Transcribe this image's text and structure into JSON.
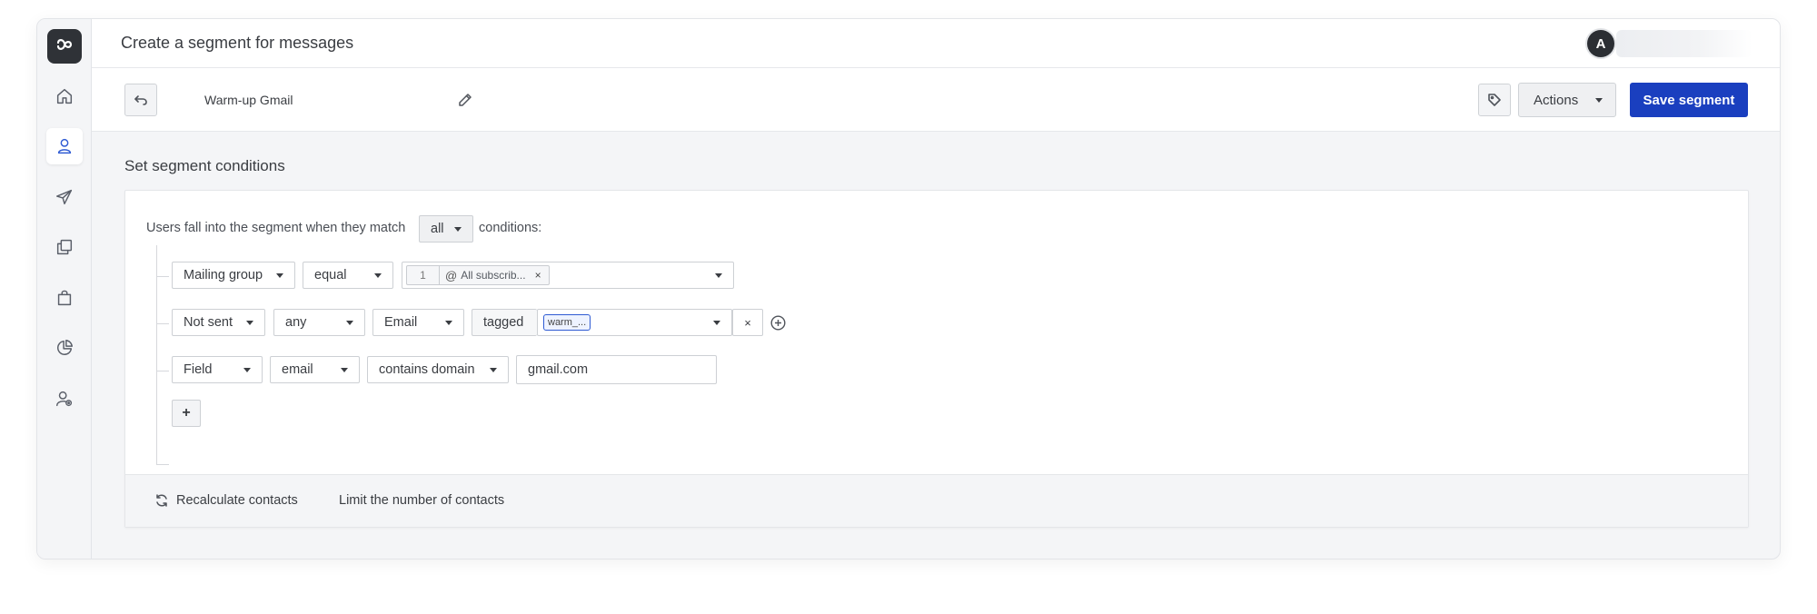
{
  "header": {
    "page_title": "Create a segment for messages",
    "avatar_initial": "A"
  },
  "toolbar": {
    "segment_name": "Warm-up Gmail",
    "actions_label": "Actions",
    "save_label": "Save segment"
  },
  "sidebar": {
    "items": [
      {
        "icon": "home-icon",
        "active": false
      },
      {
        "icon": "user-icon",
        "active": true
      },
      {
        "icon": "send-icon",
        "active": false
      },
      {
        "icon": "copy-icon",
        "active": false
      },
      {
        "icon": "bag-icon",
        "active": false
      },
      {
        "icon": "pie-chart-icon",
        "active": false
      },
      {
        "icon": "user-settings-icon",
        "active": false
      }
    ]
  },
  "conditions": {
    "section_title": "Set segment conditions",
    "match_prefix": "Users fall into the segment when they match",
    "match_value": "all",
    "match_suffix": "conditions:",
    "rows": [
      {
        "field": "Mailing group",
        "operator": "equal",
        "chip_count": "1",
        "chip_label": "All subscrib..."
      },
      {
        "field": "Not sent",
        "operator": "any",
        "channel": "Email",
        "tagged_label": "tagged",
        "tag_value": "warm_..."
      },
      {
        "field": "Field",
        "operator": "email",
        "match": "contains domain",
        "value": "gmail.com"
      }
    ],
    "add_label": "+"
  },
  "footer": {
    "recalculate_label": "Recalculate contacts",
    "limit_label": "Limit the number of contacts"
  },
  "colors": {
    "primary": "#1a3fbf",
    "sidebar_bg": "#f4f5f7",
    "logo_bg": "#2f3237"
  }
}
